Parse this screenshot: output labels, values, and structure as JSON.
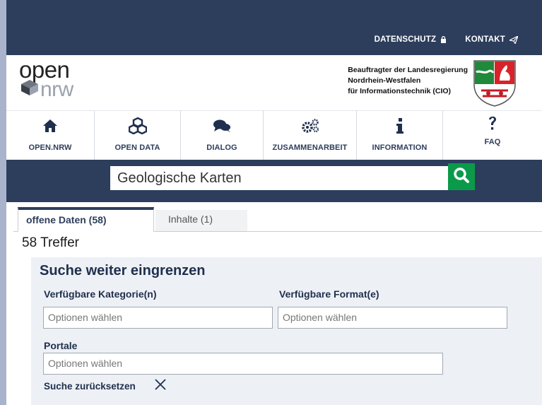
{
  "topbar": {
    "links": [
      {
        "label": "DATENSCHUTZ",
        "icon": "lock-icon"
      },
      {
        "label": "KONTAKT",
        "icon": "paper-plane-icon"
      }
    ]
  },
  "header": {
    "logo": {
      "part1": "open",
      "part2": "nrw"
    },
    "cio_lines": [
      "Beauftragter der Landesregierung",
      "Nordrhein-Westfalen",
      "für Informationstechnik (CIO)"
    ],
    "crest": "nrw-coat-of-arms"
  },
  "nav": {
    "items": [
      {
        "label": "OPEN.NRW",
        "icon": "home-icon"
      },
      {
        "label": "OPEN DATA",
        "icon": "cubes-icon"
      },
      {
        "label": "DIALOG",
        "icon": "comments-icon"
      },
      {
        "label": "ZUSAMMENARBEIT",
        "icon": "gears-icon"
      },
      {
        "label": "INFORMATION",
        "icon": "info-icon"
      },
      {
        "label": "FAQ",
        "icon": "question-icon"
      }
    ]
  },
  "search": {
    "value": "Geologische Karten",
    "button_icon": "search-icon",
    "button_color": "#0a9a4a"
  },
  "tabs": [
    {
      "label": "offene Daten (58)",
      "active": true
    },
    {
      "label": "Inhalte (1)",
      "active": false
    }
  ],
  "results": {
    "count_label": "58 Treffer"
  },
  "filter": {
    "title": "Suche weiter eingrenzen",
    "category": {
      "label": "Verfügbare Kategorie(n)",
      "placeholder": "Optionen wählen"
    },
    "format": {
      "label": "Verfügbare Format(e)",
      "placeholder": "Optionen wählen"
    },
    "portals": {
      "label": "Portale",
      "placeholder": "Optionen wählen"
    },
    "reset_label": "Suche zurücksetzen",
    "reset_icon": "close-icon"
  },
  "colors": {
    "primary": "#2d3e5c",
    "search_green": "#0a9a4a",
    "filter_bg": "#edf0f5"
  }
}
